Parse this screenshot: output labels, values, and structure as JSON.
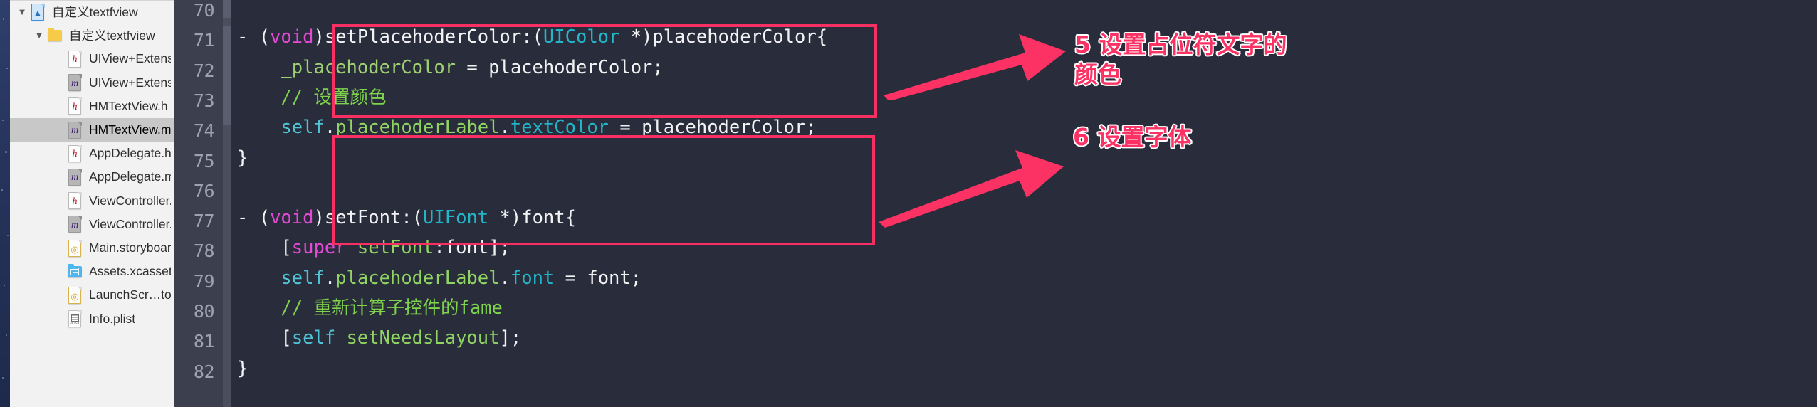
{
  "sidebar": {
    "name": "project-navigator",
    "items": [
      {
        "label": "自定义textfview",
        "icon": "xcode-project-icon",
        "indent": 0,
        "twisty": "▼",
        "selected": false,
        "kind": "proj"
      },
      {
        "label": "自定义textfview",
        "icon": "folder-icon",
        "indent": 1,
        "twisty": "▼",
        "selected": false,
        "kind": "folder"
      },
      {
        "label": "UIView+Extension.h",
        "icon": "header-file-icon",
        "indent": 2,
        "twisty": "",
        "selected": false,
        "kind": "h"
      },
      {
        "label": "UIView+Extension.m",
        "icon": "objc-file-icon",
        "indent": 2,
        "twisty": "",
        "selected": false,
        "kind": "m"
      },
      {
        "label": "HMTextView.h",
        "icon": "header-file-icon",
        "indent": 2,
        "twisty": "",
        "selected": false,
        "kind": "h"
      },
      {
        "label": "HMTextView.m",
        "icon": "objc-file-icon",
        "indent": 2,
        "twisty": "",
        "selected": true,
        "kind": "m"
      },
      {
        "label": "AppDelegate.h",
        "icon": "header-file-icon",
        "indent": 2,
        "twisty": "",
        "selected": false,
        "kind": "h"
      },
      {
        "label": "AppDelegate.m",
        "icon": "objc-file-icon",
        "indent": 2,
        "twisty": "",
        "selected": false,
        "kind": "m"
      },
      {
        "label": "ViewController.h",
        "icon": "header-file-icon",
        "indent": 2,
        "twisty": "",
        "selected": false,
        "kind": "h"
      },
      {
        "label": "ViewController.m",
        "icon": "objc-file-icon",
        "indent": 2,
        "twisty": "",
        "selected": false,
        "kind": "m"
      },
      {
        "label": "Main.storyboard",
        "icon": "storyboard-file-icon",
        "indent": 2,
        "twisty": "",
        "selected": false,
        "kind": "sb"
      },
      {
        "label": "Assets.xcassets",
        "icon": "assets-catalog-icon",
        "indent": 2,
        "twisty": "",
        "selected": false,
        "kind": "assets"
      },
      {
        "label": "LaunchScr…toryboard",
        "icon": "storyboard-file-icon",
        "indent": 2,
        "twisty": "",
        "selected": false,
        "kind": "sb"
      },
      {
        "label": "Info.plist",
        "icon": "plist-file-icon",
        "indent": 2,
        "twisty": "",
        "selected": false,
        "kind": "plist"
      }
    ]
  },
  "editor": {
    "name": "source-editor",
    "language": "objective-c",
    "line_numbers": [
      70,
      71,
      72,
      73,
      74,
      75,
      76,
      77,
      78,
      79,
      80,
      81,
      82
    ],
    "lines": [
      {
        "num": 70,
        "tokens": []
      },
      {
        "num": 71,
        "tokens": [
          {
            "t": "- ",
            "c": "t-white"
          },
          {
            "t": "(",
            "c": "t-white"
          },
          {
            "t": "void",
            "c": "t-keyword"
          },
          {
            "t": ")setPlacehoderColor:(",
            "c": "t-white"
          },
          {
            "t": "UIColor",
            "c": "t-type"
          },
          {
            "t": " *)placehoderColor{",
            "c": "t-white"
          }
        ]
      },
      {
        "num": 72,
        "tokens": [
          {
            "t": "    ",
            "c": "t-white"
          },
          {
            "t": "_placehoderColor",
            "c": "t-green"
          },
          {
            "t": " = placehoderColor;",
            "c": "t-white"
          }
        ]
      },
      {
        "num": 73,
        "tokens": [
          {
            "t": "    ",
            "c": "t-white"
          },
          {
            "t": "// 设置颜色",
            "c": "t-comment"
          }
        ]
      },
      {
        "num": 74,
        "tokens": [
          {
            "t": "    ",
            "c": "t-white"
          },
          {
            "t": "self",
            "c": "t-self"
          },
          {
            "t": ".",
            "c": "t-white"
          },
          {
            "t": "placehoderLabel",
            "c": "t-method"
          },
          {
            "t": ".",
            "c": "t-white"
          },
          {
            "t": "textColor",
            "c": "t-type"
          },
          {
            "t": " = placehoderColor;",
            "c": "t-white"
          }
        ]
      },
      {
        "num": 75,
        "tokens": [
          {
            "t": "}",
            "c": "t-white"
          }
        ]
      },
      {
        "num": 76,
        "tokens": []
      },
      {
        "num": 77,
        "tokens": [
          {
            "t": "- ",
            "c": "t-white"
          },
          {
            "t": "(",
            "c": "t-white"
          },
          {
            "t": "void",
            "c": "t-keyword"
          },
          {
            "t": ")setFont:(",
            "c": "t-white"
          },
          {
            "t": "UIFont",
            "c": "t-type"
          },
          {
            "t": " *)font{",
            "c": "t-white"
          }
        ]
      },
      {
        "num": 78,
        "tokens": [
          {
            "t": "    [",
            "c": "t-white"
          },
          {
            "t": "super",
            "c": "t-keyword"
          },
          {
            "t": " ",
            "c": "t-white"
          },
          {
            "t": "setFont",
            "c": "t-method"
          },
          {
            "t": ":font];",
            "c": "t-white"
          }
        ]
      },
      {
        "num": 79,
        "tokens": [
          {
            "t": "    ",
            "c": "t-white"
          },
          {
            "t": "self",
            "c": "t-self"
          },
          {
            "t": ".",
            "c": "t-white"
          },
          {
            "t": "placehoderLabel",
            "c": "t-method"
          },
          {
            "t": ".",
            "c": "t-white"
          },
          {
            "t": "font",
            "c": "t-type"
          },
          {
            "t": " = font;",
            "c": "t-white"
          }
        ]
      },
      {
        "num": 80,
        "tokens": [
          {
            "t": "    ",
            "c": "t-white"
          },
          {
            "t": "// 重新计算子控件的fame",
            "c": "t-comment"
          }
        ]
      },
      {
        "num": 81,
        "tokens": [
          {
            "t": "    [",
            "c": "t-white"
          },
          {
            "t": "self",
            "c": "t-self"
          },
          {
            "t": " ",
            "c": "t-white"
          },
          {
            "t": "setNeedsLayout",
            "c": "t-method"
          },
          {
            "t": "];",
            "c": "t-white"
          }
        ]
      },
      {
        "num": 82,
        "tokens": [
          {
            "t": "}",
            "c": "t-white"
          }
        ]
      }
    ]
  },
  "annotations": [
    {
      "id": "annotation-5",
      "text": "5 设置占位符文字的\n颜色",
      "color": "#fb3263",
      "highlight_lines": "71-75"
    },
    {
      "id": "annotation-6",
      "text": "6 设置字体",
      "color": "#fb3263",
      "highlight_lines": "77-82"
    }
  ],
  "colors": {
    "annotation_pink": "#fb3263",
    "editor_background": "#292c3a",
    "gutter_background": "#3b3f4e",
    "sidebar_background": "#f2f2f2",
    "selection_background": "#c8c8c8",
    "keyword": "#e24ad6",
    "type": "#23b6c9",
    "comment": "#7fd34d",
    "string_green": "#9fd173",
    "method": "#90d463",
    "self_keyword": "#4fc4d6"
  }
}
